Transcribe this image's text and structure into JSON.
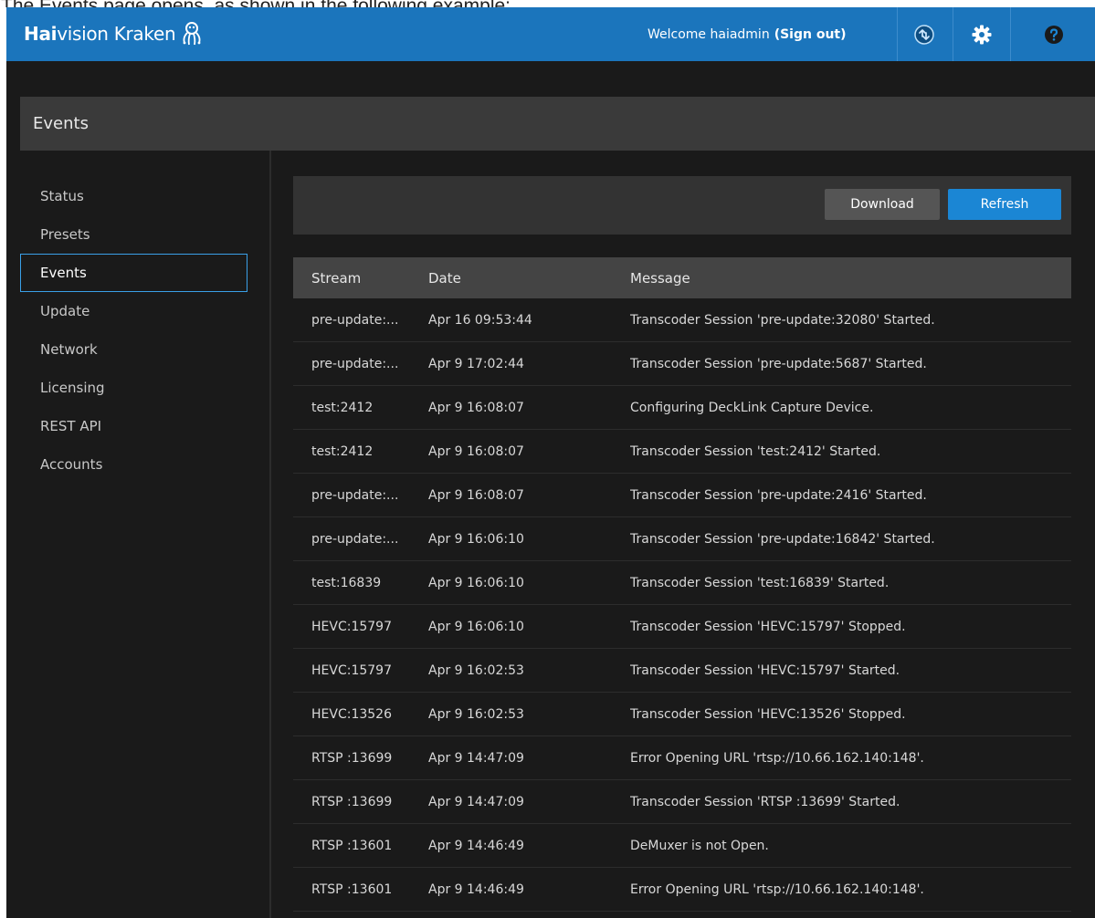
{
  "caption": {
    "prefix": "The ",
    "highlight": "Events",
    "suffix": " page opens, as shown in the following example:"
  },
  "topbar": {
    "brand_bold": "Hai",
    "brand_rest": "vision",
    "product": "Kraken",
    "welcome": "Welcome haiadmin",
    "sign_out": "(Sign out)",
    "icons": [
      "status-sync-icon",
      "gear-icon",
      "help-icon"
    ],
    "accent_color": "#1b75bc"
  },
  "header": {
    "title": "Events"
  },
  "sidebar": {
    "items": [
      {
        "label": "Status"
      },
      {
        "label": "Presets"
      },
      {
        "label": "Events",
        "active": true
      },
      {
        "label": "Update"
      },
      {
        "label": "Network"
      },
      {
        "label": "Licensing"
      },
      {
        "label": "REST API"
      },
      {
        "label": "Accounts"
      }
    ]
  },
  "toolbar": {
    "download_label": "Download",
    "refresh_label": "Refresh",
    "refresh_color": "#1b86d4"
  },
  "table": {
    "columns": [
      "Stream",
      "Date",
      "Message"
    ],
    "rows": [
      {
        "stream": "pre-update:...",
        "date": "Apr 16 09:53:44",
        "message": "Transcoder Session 'pre-update:32080' Started."
      },
      {
        "stream": "pre-update:...",
        "date": "Apr 9 17:02:44",
        "message": "Transcoder Session 'pre-update:5687' Started."
      },
      {
        "stream": "test:2412",
        "date": "Apr 9 16:08:07",
        "message": "Configuring DeckLink Capture Device."
      },
      {
        "stream": "test:2412",
        "date": "Apr 9 16:08:07",
        "message": "Transcoder Session 'test:2412' Started."
      },
      {
        "stream": "pre-update:...",
        "date": "Apr 9 16:08:07",
        "message": "Transcoder Session 'pre-update:2416' Started."
      },
      {
        "stream": "pre-update:...",
        "date": "Apr 9 16:06:10",
        "message": "Transcoder Session 'pre-update:16842' Started."
      },
      {
        "stream": "test:16839",
        "date": "Apr 9 16:06:10",
        "message": "Transcoder Session 'test:16839' Started."
      },
      {
        "stream": "HEVC:15797",
        "date": "Apr 9 16:06:10",
        "message": "Transcoder Session 'HEVC:15797' Stopped."
      },
      {
        "stream": "HEVC:15797",
        "date": "Apr 9 16:02:53",
        "message": "Transcoder Session 'HEVC:15797' Started."
      },
      {
        "stream": "HEVC:13526",
        "date": "Apr 9 16:02:53",
        "message": "Transcoder Session 'HEVC:13526' Stopped."
      },
      {
        "stream": "RTSP :13699",
        "date": "Apr 9 14:47:09",
        "message": "Error Opening URL 'rtsp://10.66.162.140:148'."
      },
      {
        "stream": "RTSP :13699",
        "date": "Apr 9 14:47:09",
        "message": "Transcoder Session 'RTSP :13699' Started."
      },
      {
        "stream": "RTSP :13601",
        "date": "Apr 9 14:46:49",
        "message": "DeMuxer is not Open."
      },
      {
        "stream": "RTSP :13601",
        "date": "Apr 9 14:46:49",
        "message": "Error Opening URL 'rtsp://10.66.162.140:148'."
      }
    ]
  }
}
